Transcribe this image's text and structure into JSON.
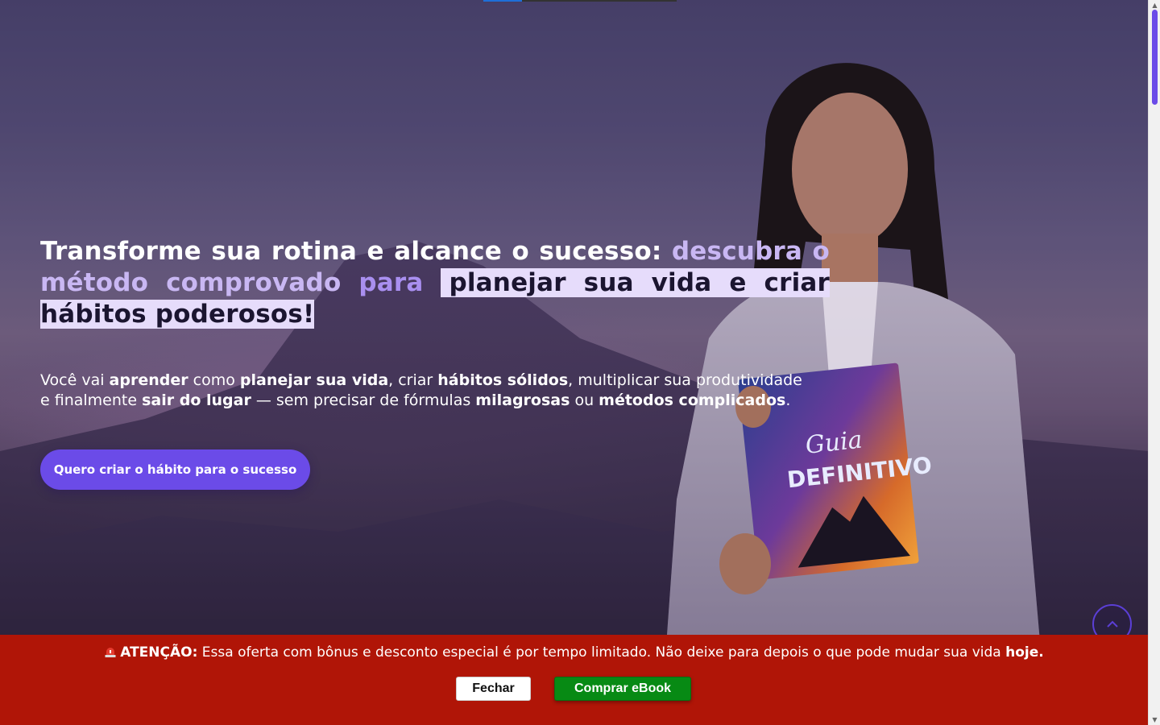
{
  "hero": {
    "headline": {
      "part1": "Transforme sua rotina e alcance o sucesso: ",
      "part2": "descubra o método comprovado ",
      "part3": "para",
      "part4": "planejar sua vida e criar hábitos poderosos!"
    },
    "subtitle": {
      "t1": "Você vai ",
      "b1": "aprender",
      "t2": " como ",
      "b2": "planejar sua vida",
      "t3": ", criar ",
      "b3": "hábitos sólidos",
      "t4": ", multiplicar sua produtividade e finalmente ",
      "b4": "sair do lugar",
      "t5": " — sem precisar de fórmulas ",
      "b5": "milagrosas",
      "t6": " ou ",
      "b6": "métodos complicados",
      "t7": "."
    },
    "cta_label": "Quero criar o hábito para o sucesso",
    "book": {
      "title_line1": "Guia",
      "title_line2": "DEFINITIVO"
    }
  },
  "banner": {
    "icon": "siren-icon",
    "label": "ATENÇÃO:",
    "message": " Essa oferta com bônus e desconto especial é por tempo limitado. Não deixe para depois o que pode mudar sua vida ",
    "emphasis": "hoje.",
    "close_label": "Fechar",
    "buy_label": "Comprar eBook"
  },
  "colors": {
    "accent": "#6b4be8",
    "banner": "#b01507",
    "buy": "#078a14"
  }
}
